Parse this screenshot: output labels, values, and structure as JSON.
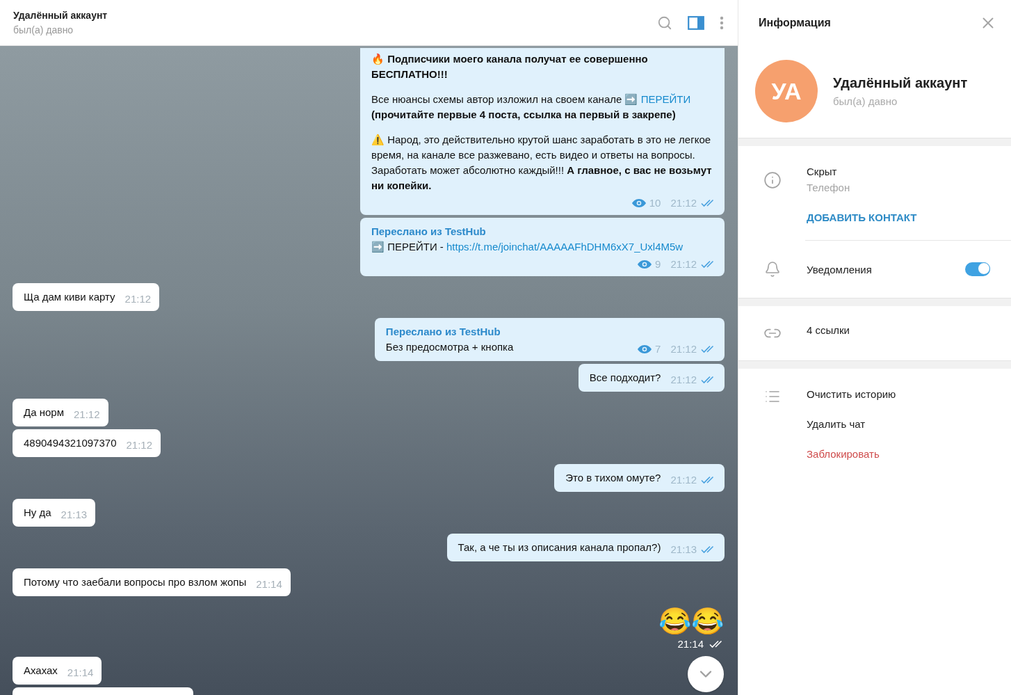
{
  "chat_header": {
    "title": "Удалённый аккаунт",
    "status": "был(а) давно"
  },
  "messages": [
    {
      "outgoing": true,
      "kind": "text",
      "paragraphs": [
        [
          {
            "kind": "plain",
            "text": "🔥 "
          },
          {
            "kind": "bold",
            "text": "Подписчики моего канала получат ее совершенно БЕСПЛАТНО!!!"
          }
        ],
        [
          {
            "kind": "plain",
            "text": "Все нюансы схемы автор изложил на своем канале ➡️ "
          },
          {
            "kind": "link",
            "text": "ПЕРЕЙТИ"
          },
          {
            "kind": "bold",
            "text": " (прочитайте первые 4 поста, ссылка на первый в закрепе)"
          }
        ],
        [
          {
            "kind": "plain",
            "text": "⚠️ Народ, это действительно крутой шанс заработать в это не легкое время, на канале все разжевано, есть видео и ответы на вопросы. Заработать может абсолютно каждый!!! "
          },
          {
            "kind": "bold",
            "text": "А главное, с вас не возьмут ни копейки."
          }
        ]
      ],
      "views": "10",
      "time": "21:12",
      "read": true
    },
    {
      "outgoing": true,
      "kind": "text",
      "forwarded_from": "Переслано из TestHub",
      "paragraphs": [
        [
          {
            "kind": "plain",
            "text": "➡️ ПЕРЕЙТИ - "
          },
          {
            "kind": "link",
            "text": "https://t.me/joinchat/AAAAAFhDHM6xX7_Uxl4M5w"
          }
        ]
      ],
      "views": "9",
      "time": "21:12",
      "read": true
    },
    {
      "outgoing": false,
      "kind": "text",
      "paragraphs": [
        [
          {
            "kind": "plain",
            "text": "Ща дам киви карту"
          }
        ]
      ],
      "time": "21:12"
    },
    {
      "outgoing": true,
      "kind": "text",
      "forwarded_from": "Переслано из TestHub",
      "paragraphs": [
        [
          {
            "kind": "plain",
            "text": "Без предосмотра + кнопка"
          }
        ]
      ],
      "views": "7",
      "time": "21:12",
      "read": true
    },
    {
      "outgoing": true,
      "kind": "text",
      "paragraphs": [
        [
          {
            "kind": "plain",
            "text": "Все подходит?"
          }
        ]
      ],
      "time": "21:12",
      "read": true
    },
    {
      "outgoing": false,
      "kind": "text",
      "paragraphs": [
        [
          {
            "kind": "plain",
            "text": "Да норм"
          }
        ]
      ],
      "time": "21:12"
    },
    {
      "outgoing": false,
      "kind": "text",
      "paragraphs": [
        [
          {
            "kind": "plain",
            "text": "4890494321097370"
          }
        ]
      ],
      "time": "21:12"
    },
    {
      "outgoing": true,
      "kind": "text",
      "paragraphs": [
        [
          {
            "kind": "plain",
            "text": "Это в тихом омуте?"
          }
        ]
      ],
      "time": "21:12",
      "read": true
    },
    {
      "outgoing": false,
      "kind": "text",
      "paragraphs": [
        [
          {
            "kind": "plain",
            "text": "Ну да"
          }
        ]
      ],
      "time": "21:13"
    },
    {
      "outgoing": true,
      "kind": "text",
      "paragraphs": [
        [
          {
            "kind": "plain",
            "text": "Так, а че ты из описания канала пропал?)"
          }
        ]
      ],
      "time": "21:13",
      "read": true
    },
    {
      "outgoing": false,
      "kind": "text",
      "paragraphs": [
        [
          {
            "kind": "plain",
            "text": "Потому что заебали вопросы про взлом жопы"
          }
        ]
      ],
      "time": "21:14"
    },
    {
      "outgoing": true,
      "kind": "emoji",
      "text": "😂😂",
      "time": "21:14",
      "read": true
    },
    {
      "outgoing": false,
      "kind": "text",
      "paragraphs": [
        [
          {
            "kind": "plain",
            "text": "Ахахах"
          }
        ]
      ],
      "time": "21:14"
    },
    {
      "outgoing": false,
      "kind": "clipped"
    }
  ],
  "info_panel": {
    "title": "Информация",
    "profile": {
      "initials": "УА",
      "name": "Удалённый аккаунт",
      "status": "был(а) давно"
    },
    "phone": {
      "value": "Скрыт",
      "label": "Телефон"
    },
    "add_contact": "ДОБАВИТЬ КОНТАКТ",
    "notifications": {
      "label": "Уведомления",
      "on": true
    },
    "links": "4 ссылки",
    "actions": [
      {
        "label": "Очистить историю",
        "kind": "normal"
      },
      {
        "label": "Удалить чат",
        "kind": "normal"
      },
      {
        "label": "Заблокировать",
        "kind": "danger"
      }
    ]
  }
}
